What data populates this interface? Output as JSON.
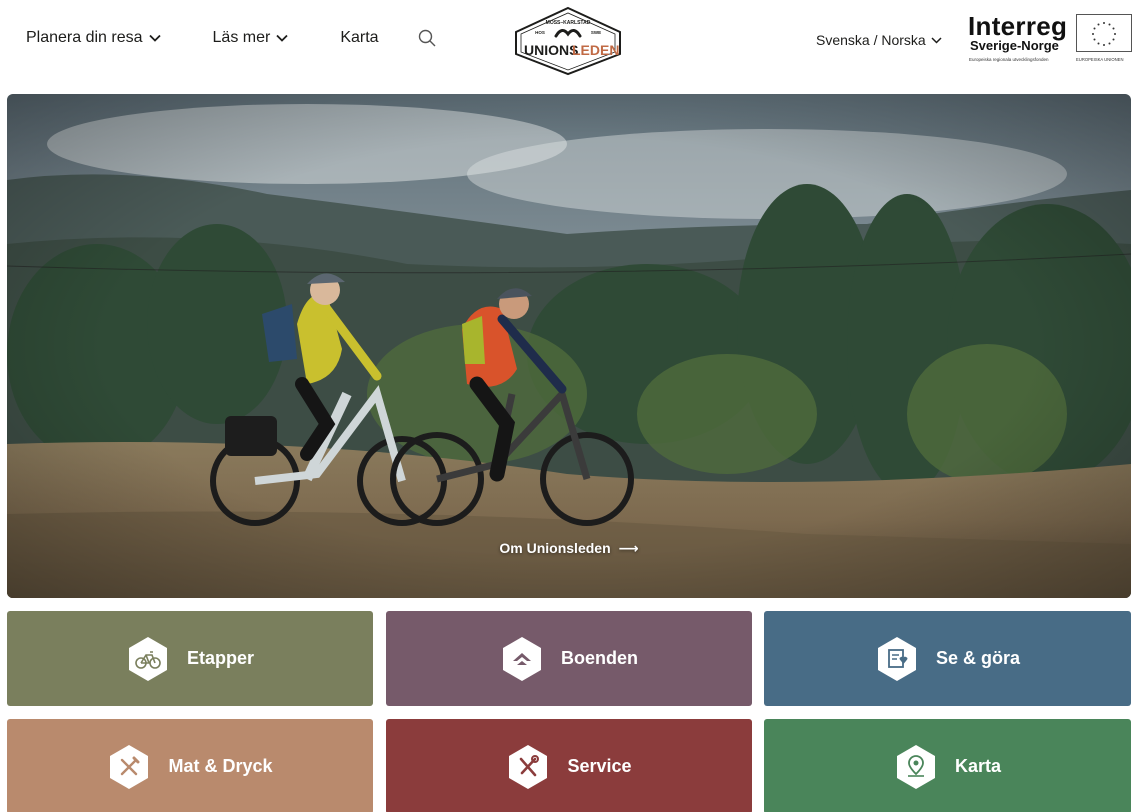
{
  "header": {
    "nav": [
      {
        "label": "Planera din resa"
      },
      {
        "label": "Läs mer"
      },
      {
        "label": "Karta"
      }
    ],
    "logo": {
      "top_text": "MOSS–KARLSTAD",
      "left_text": "HOS",
      "right_text": "SWE",
      "wordmark_part1": "UNIONS",
      "wordmark_part2": "LEDEN"
    },
    "language_label": "Svenska / Norska",
    "interreg": {
      "title": "Interreg",
      "subtitle": "Sverige-Norge",
      "fund_text": "Europeiska regionala utvecklingsfonden",
      "eu_text": "EUROPEISKA UNIONEN"
    }
  },
  "hero": {
    "link_label": "Om Unionsleden",
    "link_arrow": "⟶"
  },
  "tiles": [
    {
      "label": "Etapper",
      "color": "#7a7f5d",
      "icon": "bicycle-icon"
    },
    {
      "label": "Boenden",
      "color": "#765a6a",
      "icon": "house-icon"
    },
    {
      "label": "Se & göra",
      "color": "#486c86",
      "icon": "attraction-icon"
    },
    {
      "label": "Mat & Dryck",
      "color": "#b98a6d",
      "icon": "utensils-icon"
    },
    {
      "label": "Service",
      "color": "#8b3c3c",
      "icon": "tools-icon"
    },
    {
      "label": "Karta",
      "color": "#4a855a",
      "icon": "map-pin-icon"
    }
  ],
  "colors": {
    "text": "#1d1d1b",
    "logo_accent": "#c06a45"
  }
}
